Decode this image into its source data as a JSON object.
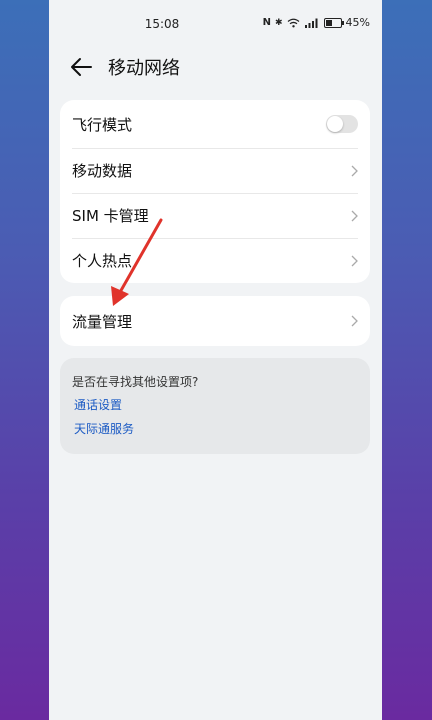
{
  "status_bar": {
    "time": "15:08",
    "nfc": "N",
    "bluetooth": "✱",
    "wifi": "wifi",
    "signal": "signal",
    "battery_percent": "45%",
    "battery_level": 0.45
  },
  "header": {
    "title": "移动网络",
    "back_icon": "arrow-left-icon"
  },
  "card_main": {
    "items": [
      {
        "label": "飞行模式",
        "control": "toggle",
        "toggle_on": false
      },
      {
        "label": "移动数据",
        "control": "chevron"
      },
      {
        "label": "SIM 卡管理",
        "control": "chevron"
      },
      {
        "label": "个人热点",
        "control": "chevron"
      }
    ]
  },
  "card_data": {
    "items": [
      {
        "label": "流量管理",
        "control": "chevron"
      }
    ]
  },
  "suggestions": {
    "title": "是否在寻找其他设置项?",
    "links": [
      "通话设置",
      "天际通服务"
    ]
  },
  "colors": {
    "link": "#1c5bc4",
    "annotation_arrow": "#e0332b",
    "page_bg": "#f1f3f5"
  }
}
